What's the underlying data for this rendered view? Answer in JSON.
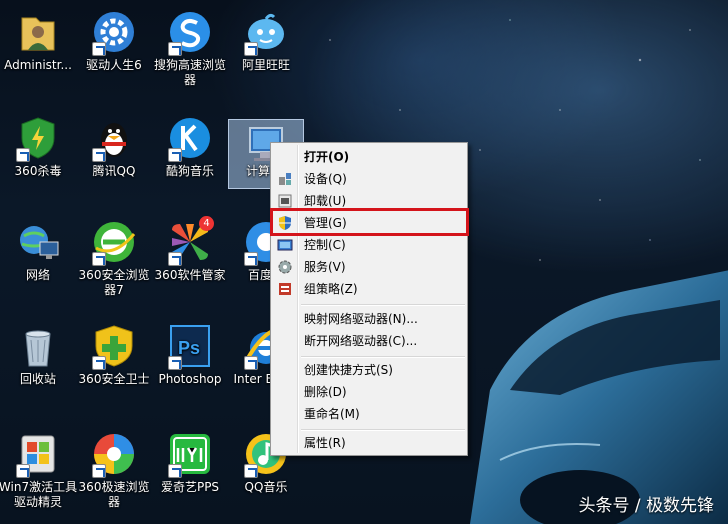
{
  "desktop": {
    "icons": [
      {
        "label": "Administr...",
        "icon": "user-folder-icon"
      },
      {
        "label": "驱动人生6",
        "icon": "driver-gear-icon"
      },
      {
        "label": "搜狗高速浏览器",
        "icon": "sogou-browser-icon"
      },
      {
        "label": "阿里旺旺",
        "icon": "aliwangwang-icon"
      },
      {
        "label": "360杀毒",
        "icon": "360-antivirus-icon"
      },
      {
        "label": "腾讯QQ",
        "icon": "qq-penguin-icon"
      },
      {
        "label": "酷狗音乐",
        "icon": "kugou-music-icon"
      },
      {
        "label": "计算",
        "icon": "computer-icon"
      },
      {
        "label": "网络",
        "icon": "network-icon"
      },
      {
        "label": "360安全浏览器7",
        "icon": "360-browser-icon"
      },
      {
        "label": "360软件管家",
        "icon": "360-software-manager-icon",
        "badge": "4"
      },
      {
        "label": "百度浏",
        "icon": "baidu-browser-icon"
      },
      {
        "label": "回收站",
        "icon": "recycle-bin-icon"
      },
      {
        "label": "360安全卫士",
        "icon": "360-guard-icon"
      },
      {
        "label": "Photoshop",
        "icon": "photoshop-icon"
      },
      {
        "label": "Inter Explo",
        "icon": "internet-explorer-icon"
      },
      {
        "label": "Win7激活工具驱动精灵",
        "icon": "win7-activator-icon"
      },
      {
        "label": "360极速浏览器",
        "icon": "360-speed-browser-icon"
      },
      {
        "label": "爱奇艺PPS",
        "icon": "iqiyi-icon"
      },
      {
        "label": "QQ音乐",
        "icon": "qq-music-icon"
      }
    ]
  },
  "context_menu": {
    "items": [
      {
        "label": "打开(O)",
        "bold": true
      },
      {
        "label": "设备(Q)",
        "icon": "device-icon"
      },
      {
        "label": "卸载(U)",
        "icon": "uninstall-icon"
      },
      {
        "label": "管理(G)",
        "icon": "uac-shield-icon"
      },
      {
        "label": "控制(C)",
        "icon": "control-icon"
      },
      {
        "label": "服务(V)",
        "icon": "services-gear-icon"
      },
      {
        "label": "组策略(Z)",
        "icon": "group-policy-icon"
      },
      {
        "label": "映射网络驱动器(N)..."
      },
      {
        "label": "断开网络驱动器(C)..."
      },
      {
        "label": "创建快捷方式(S)"
      },
      {
        "label": "删除(D)"
      },
      {
        "label": "重命名(M)"
      },
      {
        "label": "属性(R)"
      }
    ]
  },
  "highlight_color": "#d4141b",
  "watermark": "头条号 / 极数先锋"
}
